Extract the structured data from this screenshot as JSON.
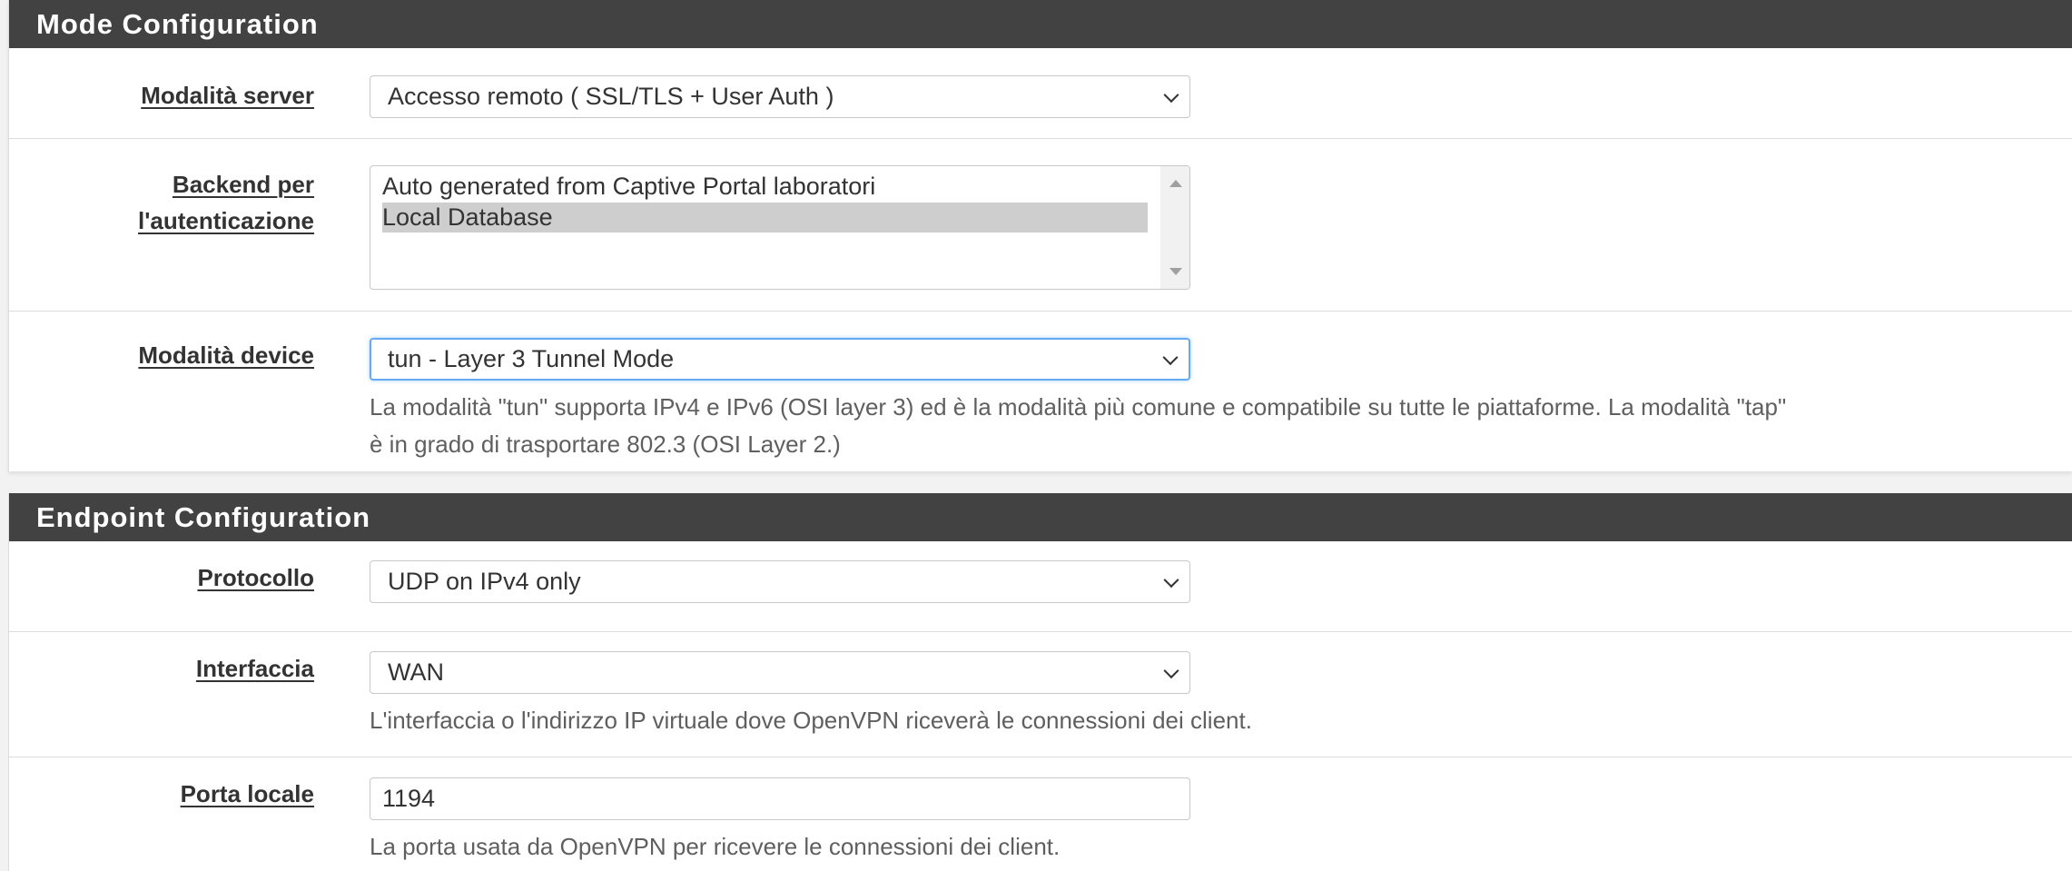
{
  "mode_config": {
    "title": "Mode Configuration",
    "server_mode": {
      "label": "Modalità server",
      "value": "Accesso remoto ( SSL/TLS + User Auth )"
    },
    "auth_backend": {
      "label_line1": "Backend per",
      "label_line2": "l'autenticazione",
      "options": [
        {
          "label": "Auto generated from Captive Portal laboratori",
          "selected": false
        },
        {
          "label": "Local Database",
          "selected": true
        }
      ]
    },
    "device_mode": {
      "label": "Modalità device",
      "value": "tun - Layer 3 Tunnel Mode",
      "help_line1": "La modalità \"tun\" supporta IPv4 e IPv6 (OSI layer 3) ed è la modalità più comune e compatibile su tutte le piattaforme. La modalità \"tap\"",
      "help_line2": "è in grado di trasportare 802.3 (OSI Layer 2.)"
    }
  },
  "endpoint_config": {
    "title": "Endpoint Configuration",
    "protocol": {
      "label": "Protocollo",
      "value": "UDP on IPv4 only"
    },
    "interface": {
      "label": "Interfaccia",
      "value": "WAN",
      "help": "L'interfaccia o l'indirizzo IP virtuale dove OpenVPN riceverà le connessioni dei client."
    },
    "local_port": {
      "label": "Porta locale",
      "value": "1194",
      "help": "La porta usata da OpenVPN per ricevere le connessioni dei client."
    }
  },
  "icons": {
    "select_arrow": "chevron-down-icon",
    "scroll_up": "arrow-up-icon",
    "scroll_down": "arrow-down-icon"
  },
  "colors": {
    "panel_heading_bg": "#424242",
    "focus_border": "#66aaf2",
    "selected_option_bg": "#cecece",
    "help_text": "#5f5f5f"
  }
}
